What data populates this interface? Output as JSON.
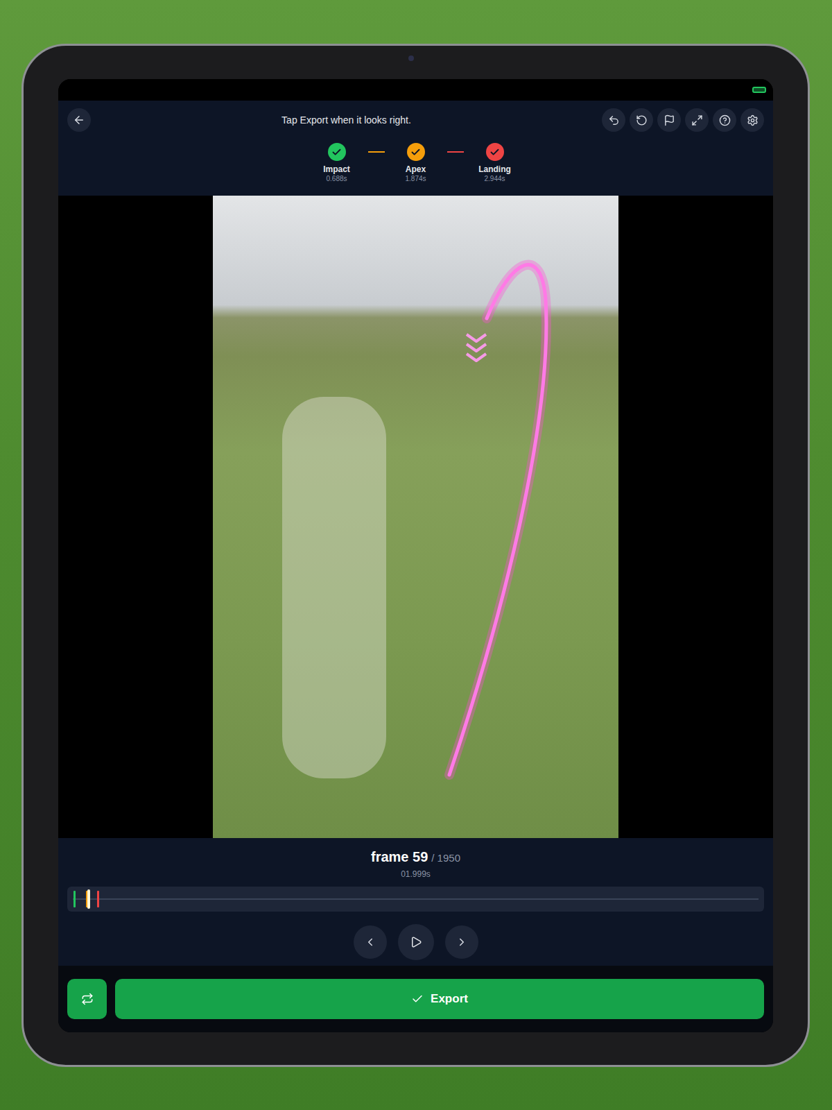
{
  "header": {
    "title": "Tap Export when it looks right."
  },
  "steps": [
    {
      "label": "Impact",
      "time": "0.688s",
      "color": "#22c55e",
      "done": true
    },
    {
      "label": "Apex",
      "time": "1.874s",
      "color": "#f59e0b",
      "done": true
    },
    {
      "label": "Landing",
      "time": "2.944s",
      "color": "#ef4444",
      "done": true
    }
  ],
  "player": {
    "frame": "frame 59",
    "total": "/ 1950",
    "time": "01.999s"
  },
  "timeline": {
    "level": 0.029,
    "markers": [
      {
        "color": "#22c55e",
        "level": 0.009
      },
      {
        "color": "#f59e0b",
        "level": 0.027
      },
      {
        "color": "#ef4444",
        "level": 0.043
      }
    ]
  },
  "buttons": {
    "export": "Export"
  }
}
